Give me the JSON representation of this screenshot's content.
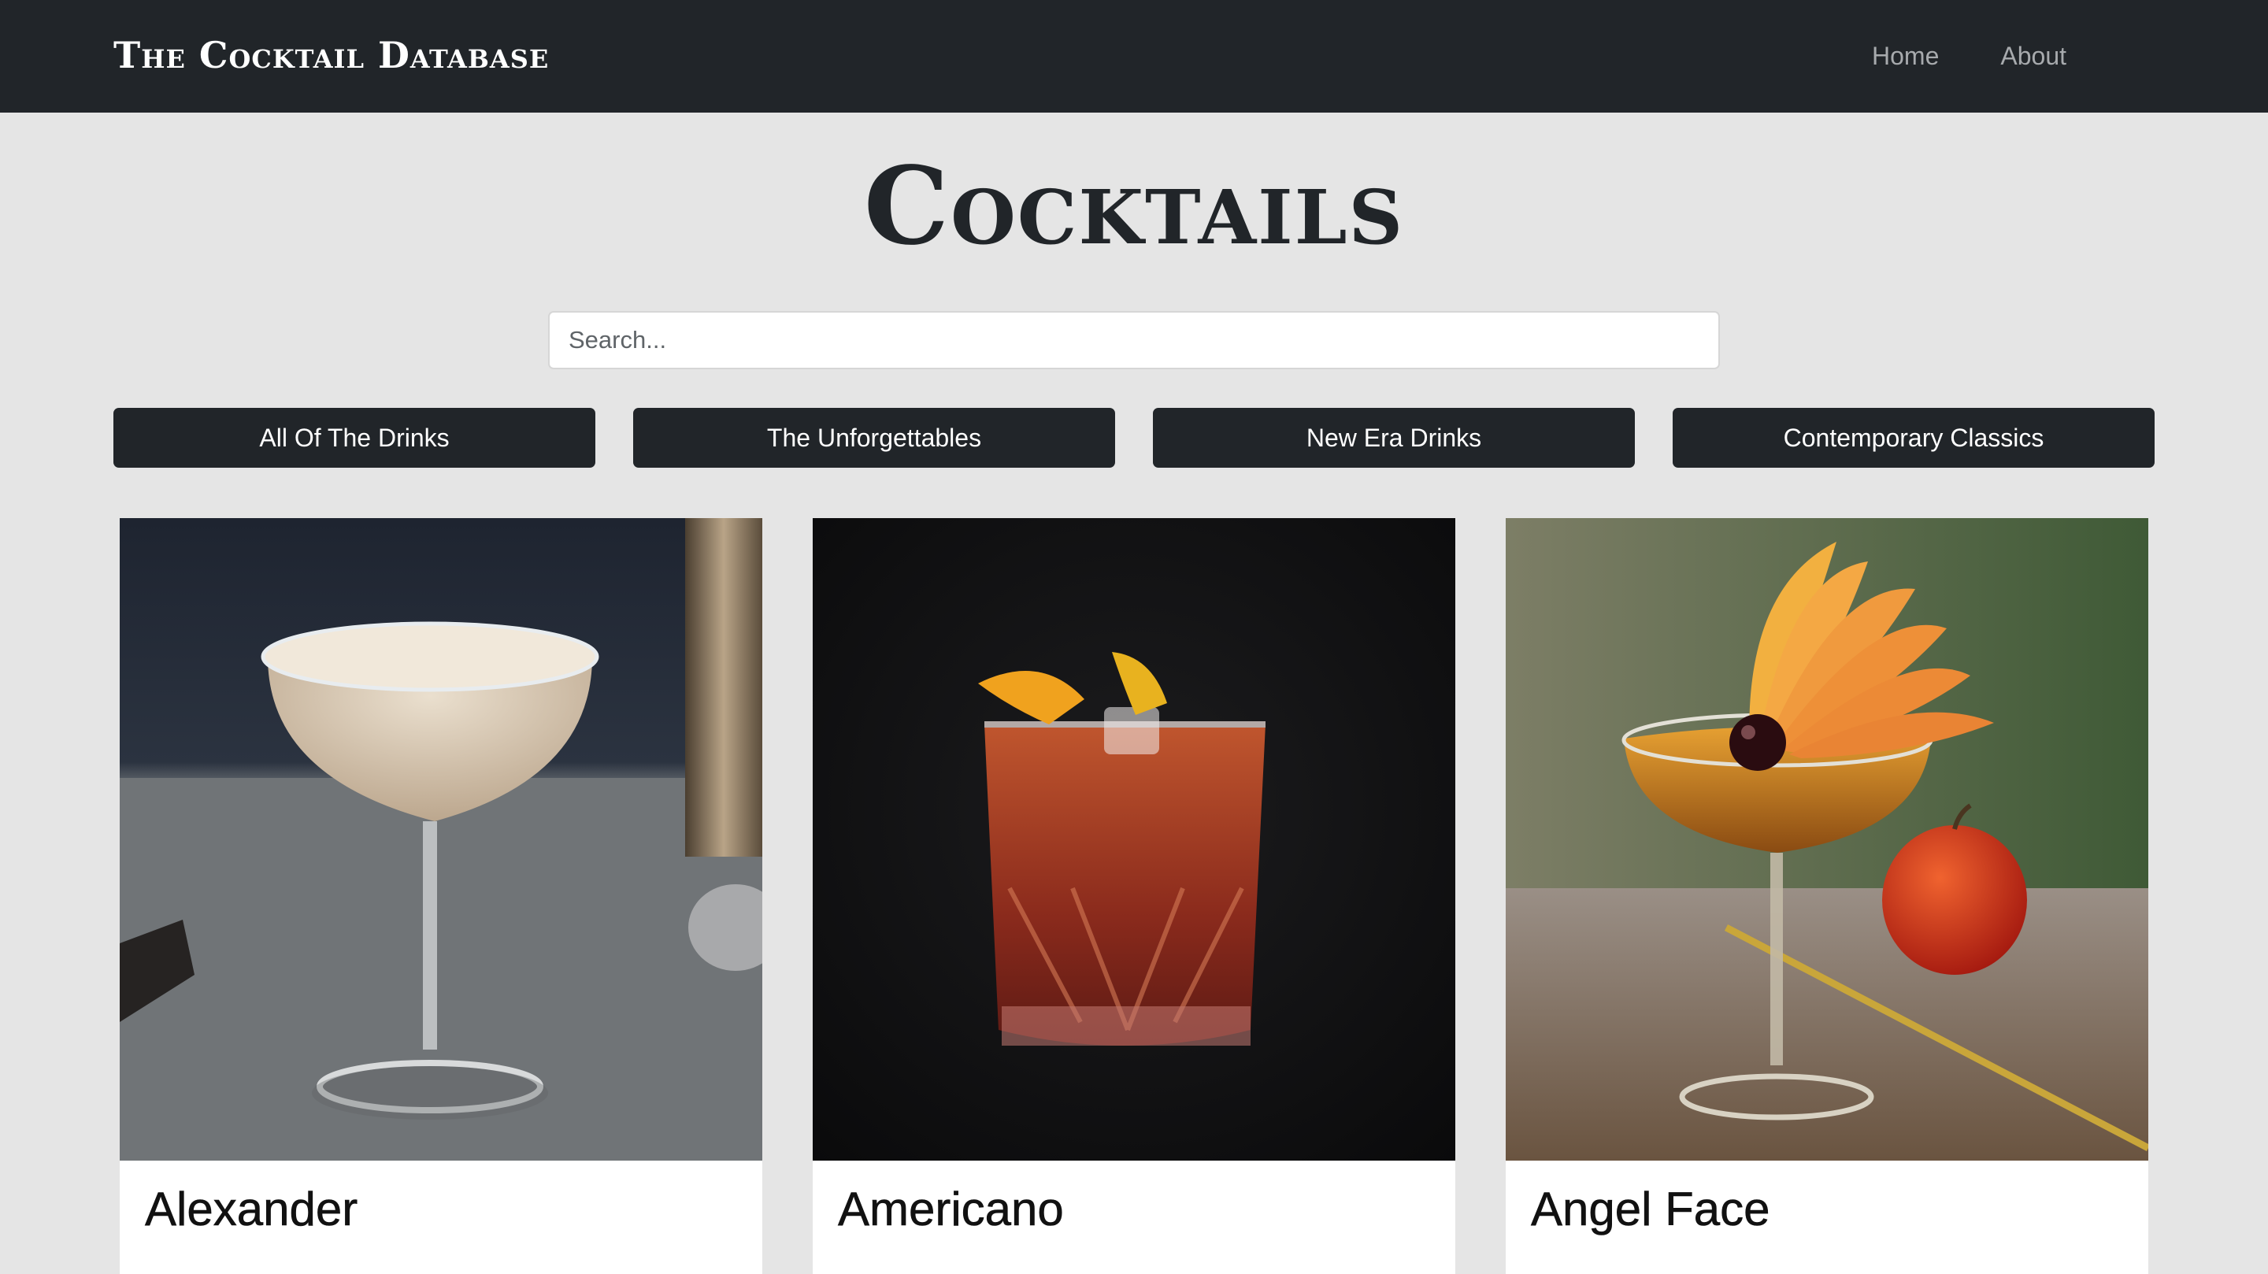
{
  "navbar": {
    "brand": "The Cocktail Database",
    "links": [
      "Home",
      "About"
    ]
  },
  "page": {
    "title": "Cocktails"
  },
  "search": {
    "value": "",
    "placeholder": "Search..."
  },
  "categories": [
    "All Of The Drinks",
    "The Unforgettables",
    "New Era Drinks",
    "Contemporary Classics"
  ],
  "cards": [
    {
      "name": "Alexander"
    },
    {
      "name": "Americano"
    },
    {
      "name": "Angel Face"
    }
  ],
  "colors": {
    "navbar_bg": "#212529",
    "page_bg": "#e5e5e5",
    "button_bg": "#212529",
    "button_text": "#ffffff",
    "nav_link": "#a7aaad"
  }
}
